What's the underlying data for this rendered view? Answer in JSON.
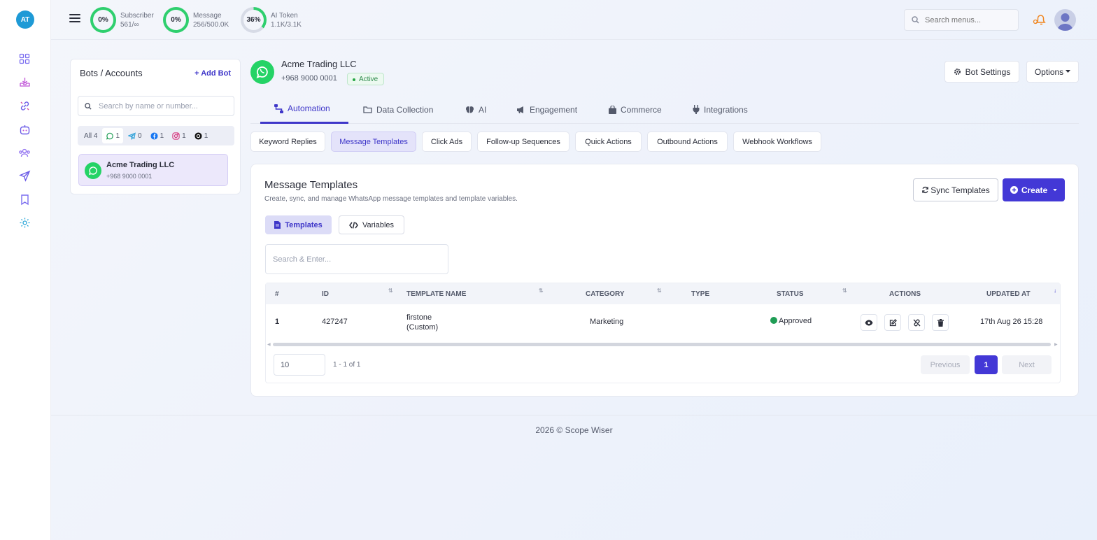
{
  "rail": {
    "avatar_initials": "AT",
    "icons": [
      "dashboard-icon",
      "inbox-download-icon",
      "link-icon",
      "bot-icon",
      "contacts-icon",
      "send-icon",
      "bookmark-icon",
      "settings-icon"
    ]
  },
  "topbar": {
    "stats": [
      {
        "percent": "0%",
        "label": "Subscriber",
        "value": "561/∞",
        "fill": 0
      },
      {
        "percent": "0%",
        "label": "Message",
        "value": "256/500.0K",
        "fill": 0
      },
      {
        "percent": "36%",
        "label": "AI Token",
        "value": "1.1K/3.1K",
        "fill": 0.36
      }
    ],
    "search_placeholder": "Search menus..."
  },
  "bots_panel": {
    "title": "Bots / Accounts",
    "add_label": "+ Add Bot",
    "search_placeholder": "Search by name or number...",
    "filters": {
      "all": "All 4",
      "whatsapp": "1",
      "telegram": "0",
      "facebook": "1",
      "instagram": "1",
      "threads": "1"
    },
    "items": [
      {
        "name": "Acme Trading LLC",
        "number": "+968 9000 0001"
      }
    ]
  },
  "bot_header": {
    "name": "Acme Trading LLC",
    "number": "+968 9000 0001",
    "status": "Active",
    "settings_label": "Bot Settings",
    "options_label": "Options"
  },
  "tabs": [
    "Automation",
    "Data Collection",
    "AI",
    "Engagement",
    "Commerce",
    "Integrations"
  ],
  "subtabs": [
    "Keyword Replies",
    "Message Templates",
    "Click Ads",
    "Follow-up Sequences",
    "Quick Actions",
    "Outbound Actions",
    "Webhook Workflows"
  ],
  "card": {
    "title": "Message Templates",
    "subtitle": "Create, sync, and manage WhatsApp message templates and template variables.",
    "sync_label": "Sync Templates",
    "create_label": "Create",
    "view_tabs": {
      "templates": "Templates",
      "variables": "Variables"
    },
    "search_placeholder": "Search & Enter...",
    "columns": {
      "num": "#",
      "id": "ID",
      "name": "TEMPLATE NAME",
      "category": "CATEGORY",
      "type": "TYPE",
      "status": "STATUS",
      "actions": "ACTIONS",
      "updated": "UPDATED AT"
    },
    "rows": [
      {
        "num": "1",
        "id": "427247",
        "name_line1": "firstone",
        "name_line2": "(Custom)",
        "category": "Marketing",
        "type": "",
        "status": "Approved",
        "updated": "17th Aug 26 15:28"
      }
    ],
    "page_size": "10",
    "range": "1 - 1 of 1",
    "prev_label": "Previous",
    "current_page": "1",
    "next_label": "Next"
  },
  "footer": {
    "text": "2026 © Scope Wiser"
  },
  "colors": {
    "accent": "#4338d6",
    "whatsapp": "#25d366",
    "ring": "#2fcf6e"
  }
}
